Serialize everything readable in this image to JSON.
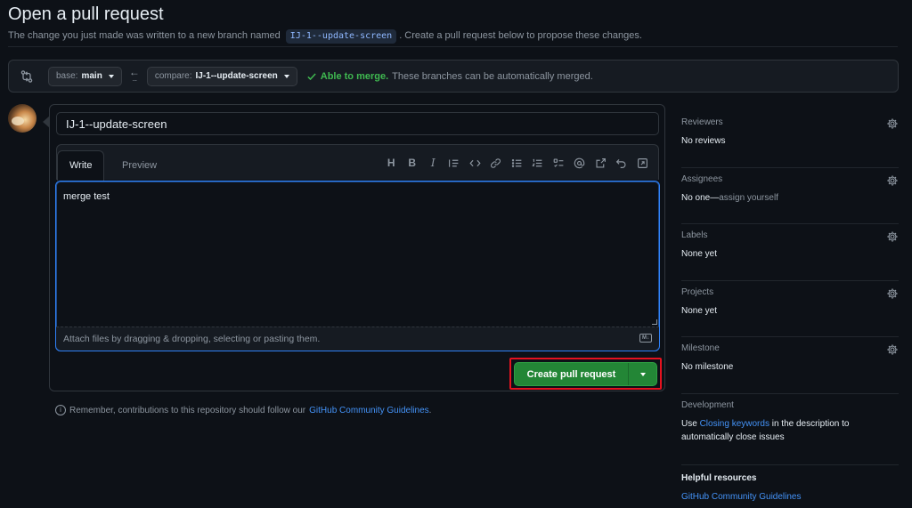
{
  "header": {
    "title": "Open a pull request",
    "subtitle_before": "The change you just made was written to a new branch named",
    "branch_code": "IJ-1--update-screen",
    "subtitle_after": ". Create a pull request below to propose these changes."
  },
  "compare": {
    "base_prefix": "base:",
    "base_branch": "main",
    "compare_prefix": "compare:",
    "compare_branch": "IJ-1--update-screen",
    "merge_title": "Able to merge.",
    "merge_text": "These branches can be automatically merged."
  },
  "editor": {
    "title_value": "IJ-1--update-screen",
    "tab_write": "Write",
    "tab_preview": "Preview",
    "body_text": "merge test",
    "attach_hint": "Attach files by dragging & dropping, selecting or pasting them.",
    "toolbar_icons": [
      "heading-icon",
      "bold-icon",
      "italic-icon",
      "quote-icon",
      "code-icon",
      "link-icon",
      "unordered-list-icon",
      "ordered-list-icon",
      "task-list-icon",
      "mention-icon",
      "reference-icon",
      "undo-icon",
      "fullscreen-icon"
    ]
  },
  "actions": {
    "create_label": "Create pull request"
  },
  "footnote": {
    "text": "Remember, contributions to this repository should follow our",
    "link": "GitHub Community Guidelines",
    "end": "."
  },
  "sidebar": {
    "reviewers": {
      "heading": "Reviewers",
      "value": "No reviews"
    },
    "assignees": {
      "heading": "Assignees",
      "value": "No one—",
      "value_muted": "assign yourself"
    },
    "labels": {
      "heading": "Labels",
      "value": "None yet"
    },
    "projects": {
      "heading": "Projects",
      "value": "None yet"
    },
    "milestone": {
      "heading": "Milestone",
      "value": "No milestone"
    },
    "development": {
      "heading": "Development",
      "text_before": "Use",
      "link": "Closing keywords",
      "text_after": "in the description to automatically close issues"
    },
    "helpful": {
      "heading": "Helpful resources",
      "link": "GitHub Community Guidelines"
    }
  },
  "colors": {
    "accent": "#2f81f7",
    "success": "#3fb950",
    "primary_button": "#238636",
    "highlight": "#e5121f"
  }
}
